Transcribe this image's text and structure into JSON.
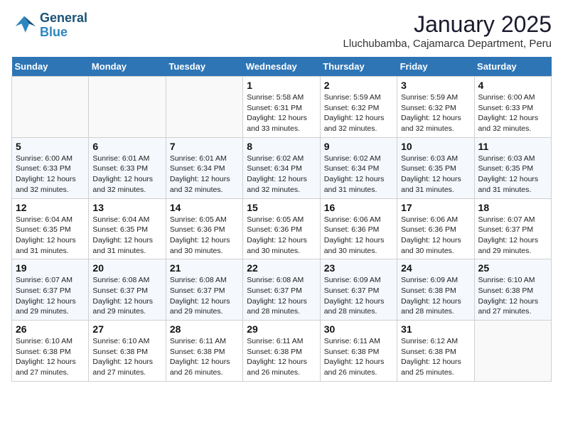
{
  "logo": {
    "line1": "General",
    "line2": "Blue"
  },
  "title": "January 2025",
  "subtitle": "Lluchubamba, Cajamarca Department, Peru",
  "days_of_week": [
    "Sunday",
    "Monday",
    "Tuesday",
    "Wednesday",
    "Thursday",
    "Friday",
    "Saturday"
  ],
  "weeks": [
    [
      {
        "num": "",
        "info": ""
      },
      {
        "num": "",
        "info": ""
      },
      {
        "num": "",
        "info": ""
      },
      {
        "num": "1",
        "info": "Sunrise: 5:58 AM\nSunset: 6:31 PM\nDaylight: 12 hours and 33 minutes."
      },
      {
        "num": "2",
        "info": "Sunrise: 5:59 AM\nSunset: 6:32 PM\nDaylight: 12 hours and 32 minutes."
      },
      {
        "num": "3",
        "info": "Sunrise: 5:59 AM\nSunset: 6:32 PM\nDaylight: 12 hours and 32 minutes."
      },
      {
        "num": "4",
        "info": "Sunrise: 6:00 AM\nSunset: 6:33 PM\nDaylight: 12 hours and 32 minutes."
      }
    ],
    [
      {
        "num": "5",
        "info": "Sunrise: 6:00 AM\nSunset: 6:33 PM\nDaylight: 12 hours and 32 minutes."
      },
      {
        "num": "6",
        "info": "Sunrise: 6:01 AM\nSunset: 6:33 PM\nDaylight: 12 hours and 32 minutes."
      },
      {
        "num": "7",
        "info": "Sunrise: 6:01 AM\nSunset: 6:34 PM\nDaylight: 12 hours and 32 minutes."
      },
      {
        "num": "8",
        "info": "Sunrise: 6:02 AM\nSunset: 6:34 PM\nDaylight: 12 hours and 32 minutes."
      },
      {
        "num": "9",
        "info": "Sunrise: 6:02 AM\nSunset: 6:34 PM\nDaylight: 12 hours and 31 minutes."
      },
      {
        "num": "10",
        "info": "Sunrise: 6:03 AM\nSunset: 6:35 PM\nDaylight: 12 hours and 31 minutes."
      },
      {
        "num": "11",
        "info": "Sunrise: 6:03 AM\nSunset: 6:35 PM\nDaylight: 12 hours and 31 minutes."
      }
    ],
    [
      {
        "num": "12",
        "info": "Sunrise: 6:04 AM\nSunset: 6:35 PM\nDaylight: 12 hours and 31 minutes."
      },
      {
        "num": "13",
        "info": "Sunrise: 6:04 AM\nSunset: 6:35 PM\nDaylight: 12 hours and 31 minutes."
      },
      {
        "num": "14",
        "info": "Sunrise: 6:05 AM\nSunset: 6:36 PM\nDaylight: 12 hours and 30 minutes."
      },
      {
        "num": "15",
        "info": "Sunrise: 6:05 AM\nSunset: 6:36 PM\nDaylight: 12 hours and 30 minutes."
      },
      {
        "num": "16",
        "info": "Sunrise: 6:06 AM\nSunset: 6:36 PM\nDaylight: 12 hours and 30 minutes."
      },
      {
        "num": "17",
        "info": "Sunrise: 6:06 AM\nSunset: 6:36 PM\nDaylight: 12 hours and 30 minutes."
      },
      {
        "num": "18",
        "info": "Sunrise: 6:07 AM\nSunset: 6:37 PM\nDaylight: 12 hours and 29 minutes."
      }
    ],
    [
      {
        "num": "19",
        "info": "Sunrise: 6:07 AM\nSunset: 6:37 PM\nDaylight: 12 hours and 29 minutes."
      },
      {
        "num": "20",
        "info": "Sunrise: 6:08 AM\nSunset: 6:37 PM\nDaylight: 12 hours and 29 minutes."
      },
      {
        "num": "21",
        "info": "Sunrise: 6:08 AM\nSunset: 6:37 PM\nDaylight: 12 hours and 29 minutes."
      },
      {
        "num": "22",
        "info": "Sunrise: 6:08 AM\nSunset: 6:37 PM\nDaylight: 12 hours and 28 minutes."
      },
      {
        "num": "23",
        "info": "Sunrise: 6:09 AM\nSunset: 6:37 PM\nDaylight: 12 hours and 28 minutes."
      },
      {
        "num": "24",
        "info": "Sunrise: 6:09 AM\nSunset: 6:38 PM\nDaylight: 12 hours and 28 minutes."
      },
      {
        "num": "25",
        "info": "Sunrise: 6:10 AM\nSunset: 6:38 PM\nDaylight: 12 hours and 27 minutes."
      }
    ],
    [
      {
        "num": "26",
        "info": "Sunrise: 6:10 AM\nSunset: 6:38 PM\nDaylight: 12 hours and 27 minutes."
      },
      {
        "num": "27",
        "info": "Sunrise: 6:10 AM\nSunset: 6:38 PM\nDaylight: 12 hours and 27 minutes."
      },
      {
        "num": "28",
        "info": "Sunrise: 6:11 AM\nSunset: 6:38 PM\nDaylight: 12 hours and 26 minutes."
      },
      {
        "num": "29",
        "info": "Sunrise: 6:11 AM\nSunset: 6:38 PM\nDaylight: 12 hours and 26 minutes."
      },
      {
        "num": "30",
        "info": "Sunrise: 6:11 AM\nSunset: 6:38 PM\nDaylight: 12 hours and 26 minutes."
      },
      {
        "num": "31",
        "info": "Sunrise: 6:12 AM\nSunset: 6:38 PM\nDaylight: 12 hours and 25 minutes."
      },
      {
        "num": "",
        "info": ""
      }
    ]
  ]
}
